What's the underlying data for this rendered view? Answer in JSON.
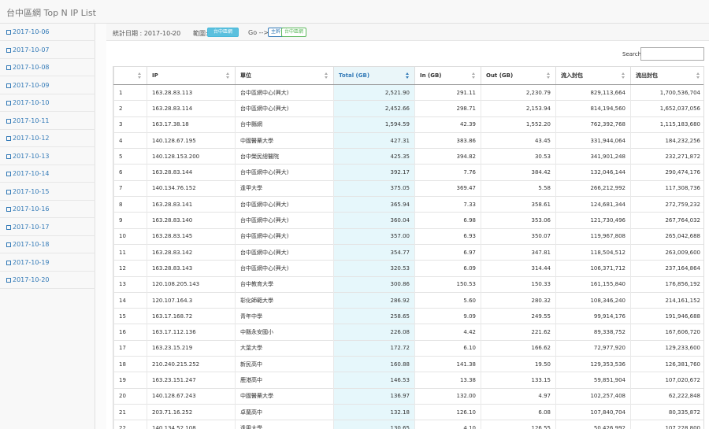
{
  "page": {
    "title": "台中區網 Top N IP List"
  },
  "sidebar": {
    "dates": [
      "2017-10-06",
      "2017-10-07",
      "2017-10-08",
      "2017-10-09",
      "2017-10-10",
      "2017-10-11",
      "2017-10-12",
      "2017-10-13",
      "2017-10-14",
      "2017-10-15",
      "2017-10-16",
      "2017-10-17",
      "2017-10-18",
      "2017-10-19",
      "2017-10-20"
    ]
  },
  "filter": {
    "date_text": "統計日期 : 2017-10-20",
    "colon": ":",
    "range_label": "範圍:",
    "range_value": "台中區網",
    "go_label": "Go -->",
    "go_options": [
      "主幹",
      "台中區網"
    ]
  },
  "search": {
    "label": "Search:",
    "value": ""
  },
  "table": {
    "columns": [
      "",
      "IP",
      "單位",
      "Total (GB)",
      "In (GB)",
      "Out (GB)",
      "流入封包",
      "流出封包"
    ],
    "sorted_column": "Total (GB)",
    "rows": [
      [
        "1",
        "163.28.83.113",
        "台中區網中心(興大)",
        "2,521.90",
        "291.11",
        "2,230.79",
        "829,113,664",
        "1,700,536,704"
      ],
      [
        "2",
        "163.28.83.114",
        "台中區網中心(興大)",
        "2,452.66",
        "298.71",
        "2,153.94",
        "814,194,560",
        "1,652,037,056"
      ],
      [
        "3",
        "163.17.38.18",
        "台中縣網",
        "1,594.59",
        "42.39",
        "1,552.20",
        "762,392,768",
        "1,115,183,680"
      ],
      [
        "4",
        "140.128.67.195",
        "中國醫藥大學",
        "427.31",
        "383.86",
        "43.45",
        "331,944,064",
        "184,232,256"
      ],
      [
        "5",
        "140.128.153.200",
        "台中榮民總醫院",
        "425.35",
        "394.82",
        "30.53",
        "341,901,248",
        "232,271,872"
      ],
      [
        "6",
        "163.28.83.144",
        "台中區網中心(興大)",
        "392.17",
        "7.76",
        "384.42",
        "132,046,144",
        "290,474,176"
      ],
      [
        "7",
        "140.134.76.152",
        "逢甲大學",
        "375.05",
        "369.47",
        "5.58",
        "266,212,992",
        "117,308,736"
      ],
      [
        "8",
        "163.28.83.141",
        "台中區網中心(興大)",
        "365.94",
        "7.33",
        "358.61",
        "124,681,344",
        "272,759,232"
      ],
      [
        "9",
        "163.28.83.140",
        "台中區網中心(興大)",
        "360.04",
        "6.98",
        "353.06",
        "121,730,496",
        "267,764,032"
      ],
      [
        "10",
        "163.28.83.145",
        "台中區網中心(興大)",
        "357.00",
        "6.93",
        "350.07",
        "119,967,808",
        "265,042,688"
      ],
      [
        "11",
        "163.28.83.142",
        "台中區網中心(興大)",
        "354.77",
        "6.97",
        "347.81",
        "118,504,512",
        "263,009,600"
      ],
      [
        "12",
        "163.28.83.143",
        "台中區網中心(興大)",
        "320.53",
        "6.09",
        "314.44",
        "106,371,712",
        "237,164,864"
      ],
      [
        "13",
        "120.108.205.143",
        "台中教育大學",
        "300.86",
        "150.53",
        "150.33",
        "161,155,840",
        "176,856,192"
      ],
      [
        "14",
        "120.107.164.3",
        "彰化師範大學",
        "286.92",
        "5.60",
        "280.32",
        "108,346,240",
        "214,161,152"
      ],
      [
        "15",
        "163.17.168.72",
        "青年中學",
        "258.65",
        "9.09",
        "249.55",
        "99,914,176",
        "191,946,688"
      ],
      [
        "16",
        "163.17.112.136",
        "中縣永安國小",
        "226.08",
        "4.42",
        "221.62",
        "89,338,752",
        "167,606,720"
      ],
      [
        "17",
        "163.23.15.219",
        "大葉大學",
        "172.72",
        "6.10",
        "166.62",
        "72,977,920",
        "129,233,600"
      ],
      [
        "18",
        "210.240.215.252",
        "新民高中",
        "160.88",
        "141.38",
        "19.50",
        "129,353,536",
        "126,381,760"
      ],
      [
        "19",
        "163.23.151.247",
        "鹿港高中",
        "146.53",
        "13.38",
        "133.15",
        "59,851,904",
        "107,020,672"
      ],
      [
        "20",
        "140.128.67.243",
        "中國醫藥大學",
        "136.97",
        "132.00",
        "4.97",
        "102,257,408",
        "62,222,848"
      ],
      [
        "21",
        "203.71.16.252",
        "卓蘭高中",
        "132.18",
        "126.10",
        "6.08",
        "107,840,704",
        "80,335,872"
      ],
      [
        "22",
        "140.134.52.108",
        "逢甲大學",
        "130.65",
        "4.10",
        "126.55",
        "50,426,992",
        "107,228,800"
      ]
    ]
  },
  "colors": {
    "accent": "#337ab7",
    "sorted_bg": "#e6f7fb",
    "pill_info": "#5bc0de",
    "pill_success": "#5cb85c"
  }
}
